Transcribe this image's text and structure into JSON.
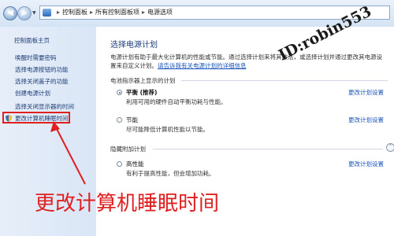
{
  "address_bar": {
    "crumbs": [
      "控制面板",
      "所有控制面板项",
      "电源选项"
    ]
  },
  "sidebar": {
    "home": "控制面板主页",
    "items": [
      {
        "label": "唤醒时需要密码"
      },
      {
        "label": "选择电源按钮的功能"
      },
      {
        "label": "选择关闭盖子的功能"
      },
      {
        "label": "创建电源计划"
      },
      {
        "label": "选择关闭显示器的时间"
      },
      {
        "label": "更改计算机睡眠时间"
      }
    ]
  },
  "main": {
    "title": "选择电源计划",
    "desc_line1": "电源计划有助于最大化计算机的性能或节能。通过选择计划来将其激活，或选择计划并通过更改其电源设",
    "desc_line2_prefix": "置来自定义计划。",
    "desc_link": "请告诉我有关电源计划的详细信息",
    "section_shown": "电池指示器上显示的计划",
    "section_hidden": "隐藏附加计划",
    "plans": [
      {
        "name": "平衡 (推荐)",
        "desc": "利用可用的硬件自动平衡功耗与性能。",
        "link": "更改计划设置",
        "selected": true
      },
      {
        "name": "节能",
        "desc": "尽可能降低计算机性能以节能。",
        "link": "更改计划设置",
        "selected": false
      },
      {
        "name": "高性能",
        "desc": "有利于提高性能，但会增加功耗。",
        "link": "更改计划设置",
        "selected": false
      }
    ]
  },
  "annotation": {
    "caption": "更改计算机睡眠时间",
    "color": "#e02020"
  },
  "watermark": {
    "text": "ID:robin553"
  },
  "icons": {
    "back": "back-arrow-icon",
    "forward": "forward-arrow-icon",
    "control_panel": "control-panel-icon",
    "shield": "uac-shield-icon",
    "collapse": "chevron-up-icon"
  }
}
